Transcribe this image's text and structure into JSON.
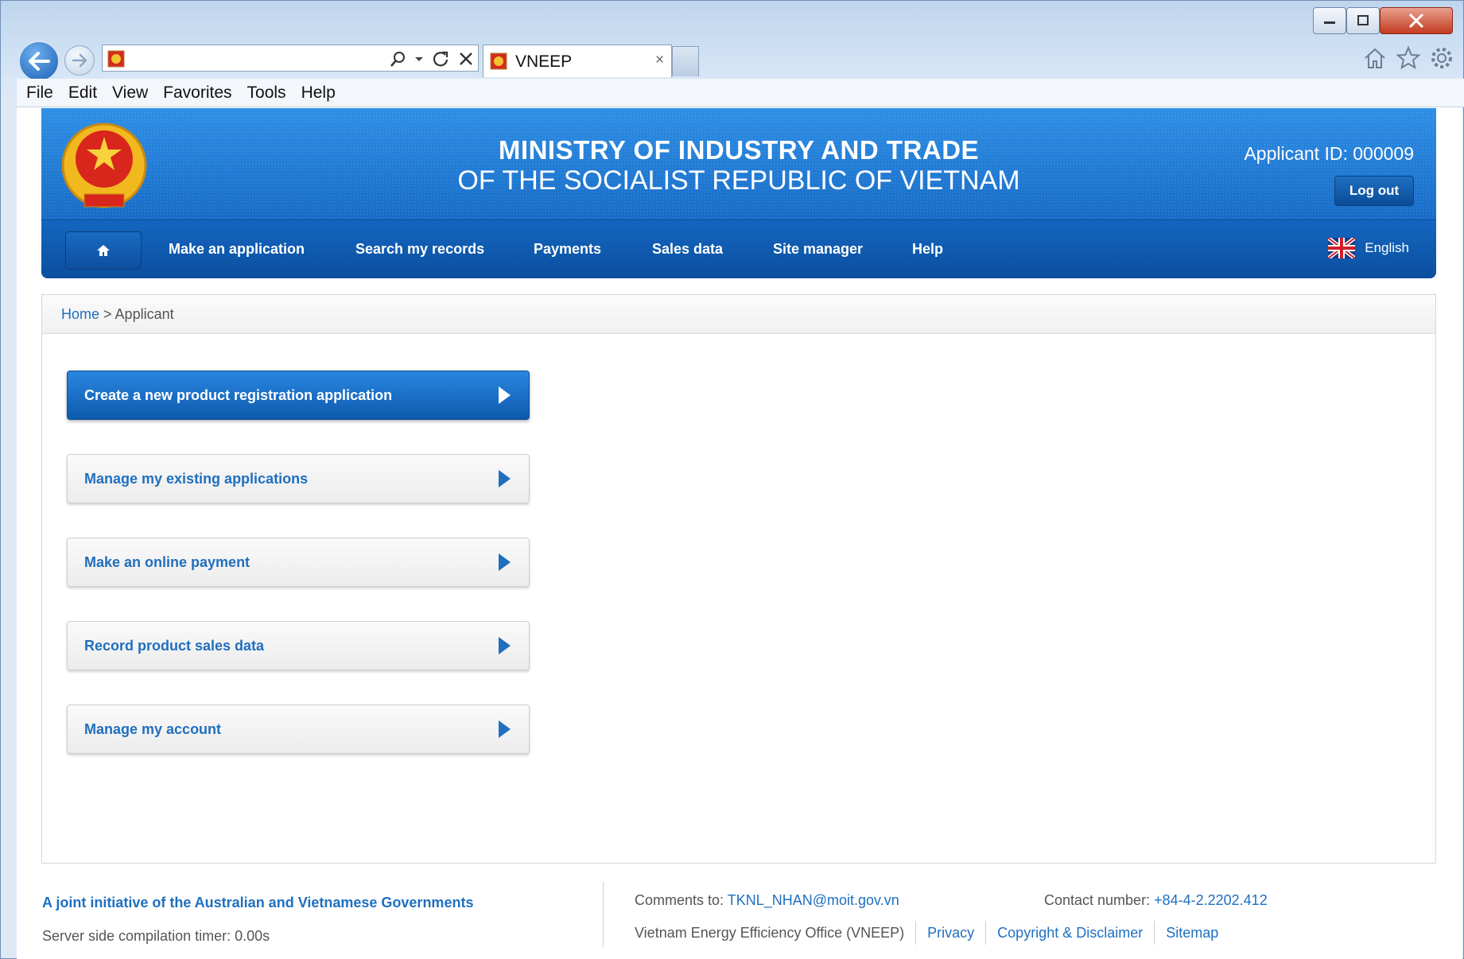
{
  "browser": {
    "tab_title": "VNEEP",
    "tab_close": "×",
    "menu": [
      "File",
      "Edit",
      "View",
      "Favorites",
      "Tools",
      "Help"
    ],
    "icons": [
      "back-icon",
      "forward-icon",
      "search-icon",
      "refresh-icon",
      "stop-icon",
      "home-icon",
      "favorites-star-icon",
      "settings-gear-icon"
    ]
  },
  "header": {
    "title": "MINISTRY OF INDUSTRY AND TRADE",
    "subtitle": "OF THE SOCIALIST REPUBLIC OF VIETNAM",
    "applicant_id": "Applicant ID: 000009",
    "logout": "Log out"
  },
  "nav": {
    "items": [
      "Make an application",
      "Search my records",
      "Payments",
      "Sales data",
      "Site manager",
      "Help"
    ],
    "language": "English"
  },
  "breadcrumb": {
    "home": "Home",
    "separator": " > ",
    "current": "Applicant"
  },
  "actions": [
    "Create a new product registration application",
    "Manage my existing applications",
    "Make an online payment",
    "Record product sales data",
    "Manage my account"
  ],
  "footer": {
    "initiative": "A joint initiative of the Australian and Vietnamese Governments",
    "timer": "Server side compilation timer: 0.00s",
    "comments_label": "Comments to: ",
    "comments_email": "TKNL_NHAN@moit.gov.vn",
    "contact_label": "Contact number: ",
    "contact_number": "+84-4-2.2202.412",
    "office": "Vietnam Energy Efficiency Office (VNEEP)",
    "links": [
      "Privacy",
      "Copyright & Disclaimer",
      "Sitemap"
    ]
  },
  "colors": {
    "brand_blue": "#1f78cf",
    "link_blue": "#1f6fbf"
  }
}
